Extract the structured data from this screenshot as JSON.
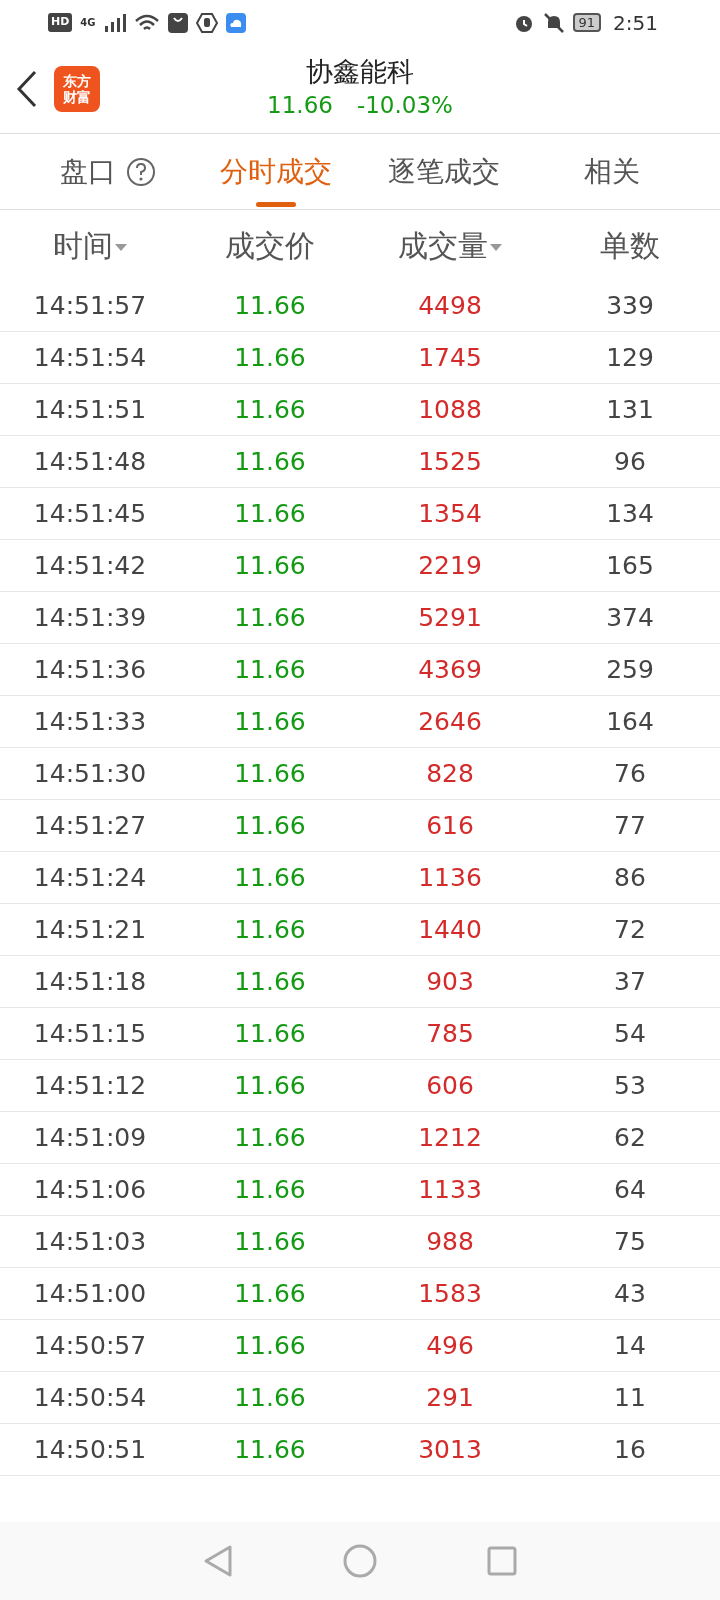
{
  "status_bar": {
    "network_badge": "HD",
    "network_type": "4G",
    "battery": "91",
    "time": "2:51"
  },
  "header": {
    "logo": "东方财富",
    "title": "协鑫能科",
    "price": "11.66",
    "change": "-10.03%"
  },
  "tabs": [
    {
      "label": "盘口",
      "help": true,
      "selected": false
    },
    {
      "label": "分时成交",
      "help": false,
      "selected": true
    },
    {
      "label": "逐笔成交",
      "help": false,
      "selected": false
    },
    {
      "label": "相关",
      "help": false,
      "selected": false
    }
  ],
  "table": {
    "columns": [
      {
        "label": "时间",
        "sortable": true
      },
      {
        "label": "成交价",
        "sortable": false
      },
      {
        "label": "成交量",
        "sortable": true
      },
      {
        "label": "单数",
        "sortable": false
      }
    ],
    "rows": [
      [
        "14:51:57",
        "11.66",
        "4498",
        "339"
      ],
      [
        "14:51:54",
        "11.66",
        "1745",
        "129"
      ],
      [
        "14:51:51",
        "11.66",
        "1088",
        "131"
      ],
      [
        "14:51:48",
        "11.66",
        "1525",
        "96"
      ],
      [
        "14:51:45",
        "11.66",
        "1354",
        "134"
      ],
      [
        "14:51:42",
        "11.66",
        "2219",
        "165"
      ],
      [
        "14:51:39",
        "11.66",
        "5291",
        "374"
      ],
      [
        "14:51:36",
        "11.66",
        "4369",
        "259"
      ],
      [
        "14:51:33",
        "11.66",
        "2646",
        "164"
      ],
      [
        "14:51:30",
        "11.66",
        "828",
        "76"
      ],
      [
        "14:51:27",
        "11.66",
        "616",
        "77"
      ],
      [
        "14:51:24",
        "11.66",
        "1136",
        "86"
      ],
      [
        "14:51:21",
        "11.66",
        "1440",
        "72"
      ],
      [
        "14:51:18",
        "11.66",
        "903",
        "37"
      ],
      [
        "14:51:15",
        "11.66",
        "785",
        "54"
      ],
      [
        "14:51:12",
        "11.66",
        "606",
        "53"
      ],
      [
        "14:51:09",
        "11.66",
        "1212",
        "62"
      ],
      [
        "14:51:06",
        "11.66",
        "1133",
        "64"
      ],
      [
        "14:51:03",
        "11.66",
        "988",
        "75"
      ],
      [
        "14:51:00",
        "11.66",
        "1583",
        "43"
      ],
      [
        "14:50:57",
        "11.66",
        "496",
        "14"
      ],
      [
        "14:50:54",
        "11.66",
        "291",
        "11"
      ],
      [
        "14:50:51",
        "11.66",
        "3013",
        "16"
      ]
    ]
  }
}
